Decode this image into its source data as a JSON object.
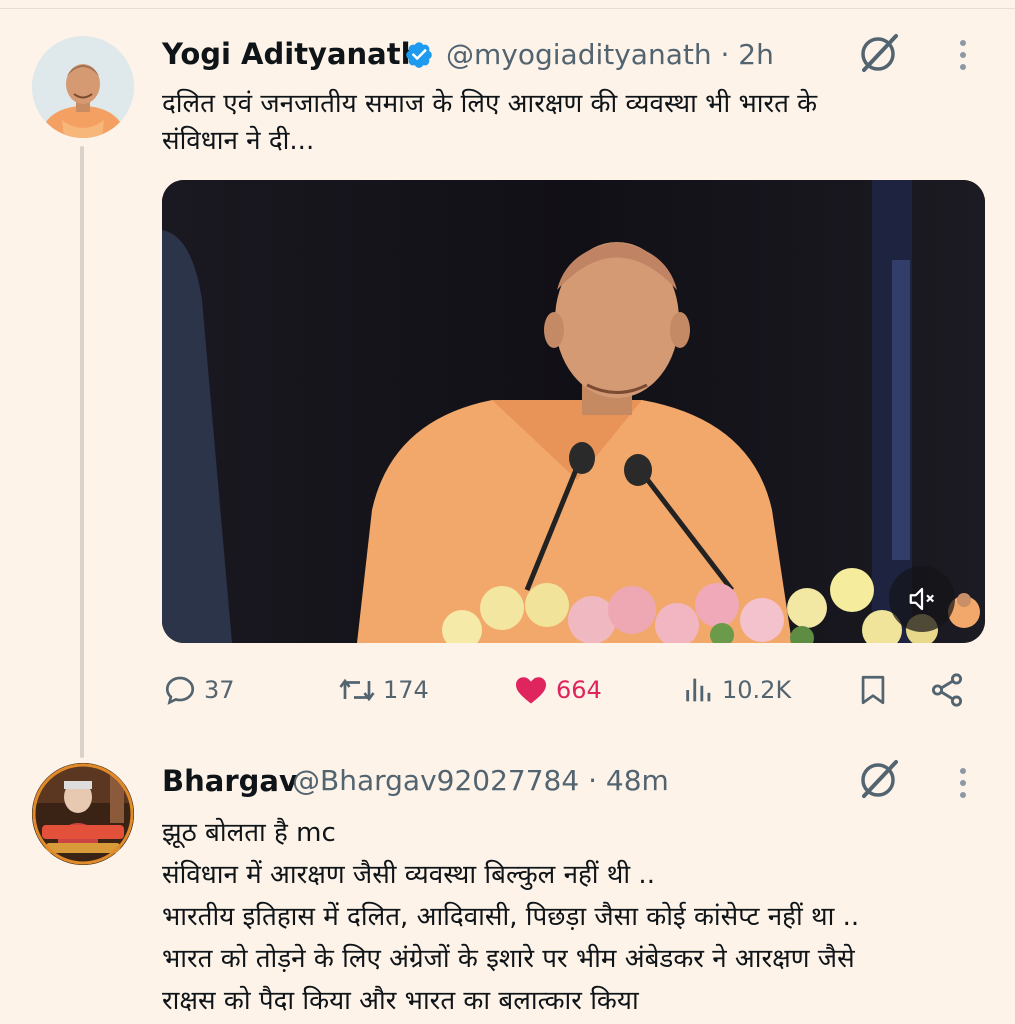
{
  "tweet": {
    "author_name": "Yogi Adityanath",
    "verified": true,
    "handle": "@myogiadityanath",
    "separator": "·",
    "time": "2h",
    "text_line1": "दलित एवं जनजातीय समाज के लिए आरक्षण की व्यवस्था भी भारत के",
    "text_line2": "संविधान ने दी...",
    "media": {
      "type": "video",
      "muted": true
    },
    "actions": {
      "replies": "37",
      "retweets": "174",
      "likes": "664",
      "views": "10.2K"
    }
  },
  "reply": {
    "author_name": "Bhargav",
    "handle": "@Bhargav92027784",
    "separator": "·",
    "time": "48m",
    "lines": [
      "झूठ बोलता है mc",
      "संविधान में आरक्षण जैसी व्यवस्था बिल्कुल नहीं थी ..",
      "भारतीय इतिहास  में दलित, आदिवासी, पिछड़ा जैसा कोई कांसेप्ट नहीं था ..",
      "भारत को तोड़ने के लिए अंग्रेजों के इशारे पर भीम अंबेडकर ने आरक्षण जैसे",
      "राक्षस को पैदा किया और भारत  का बलात्कार किया"
    ]
  },
  "colors": {
    "background": "#fdf3e8",
    "verified": "#1d9bf0",
    "like": "#e0245e",
    "secondary_text": "#536471"
  }
}
